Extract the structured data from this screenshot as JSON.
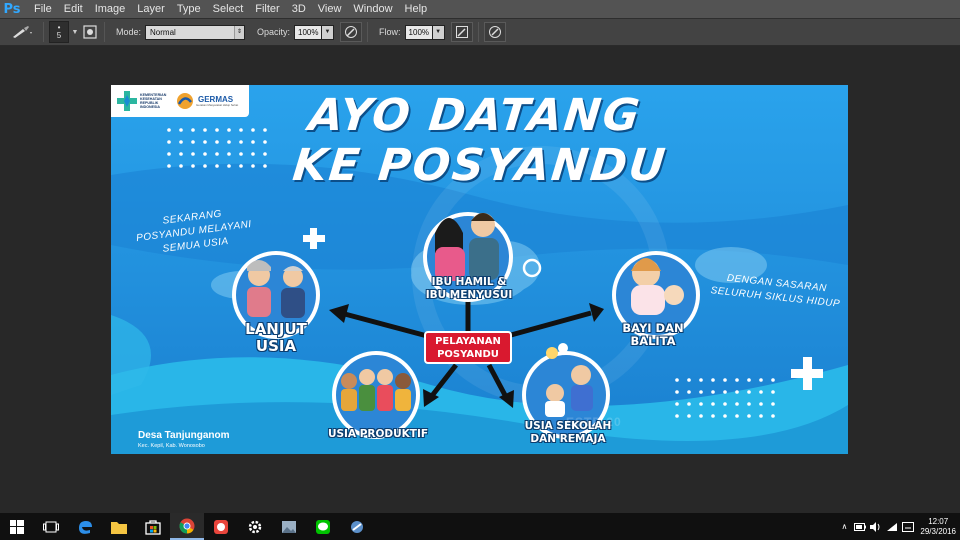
{
  "app": {
    "logo_text": "Ps"
  },
  "menu": [
    "File",
    "Edit",
    "Image",
    "Layer",
    "Type",
    "Select",
    "Filter",
    "3D",
    "View",
    "Window",
    "Help"
  ],
  "options": {
    "brush_size": "5",
    "mode_label": "Mode:",
    "mode_value": "Normal",
    "opacity_label": "Opacity:",
    "opacity_value": "100%",
    "flow_label": "Flow:",
    "flow_value": "100%"
  },
  "poster": {
    "logo_kemenkes": "KEMENTERIAN KESEHATAN REPUBLIK INDONESIA",
    "logo_germas": "GERMAS",
    "logo_germas_sub": "Gerakan Masyarakat Hidup Sehat",
    "title_line1": "AYO DATANG",
    "title_line2": "KE POSYANDU",
    "left_note": [
      "SEKARANG",
      "POSYANDU MELAYANI",
      "SEMUA USIA"
    ],
    "right_note": [
      "DENGAN SASARAN",
      "SELURUH SIKLUS HIDUP"
    ],
    "center": [
      "PELAYANAN",
      "POSYANDU"
    ],
    "groups": {
      "ibu": [
        "IBU HAMIL &",
        "IBU MENYUSUI"
      ],
      "lansia": [
        "LANJUT",
        "USIA"
      ],
      "bayi": [
        "BAYI DAN",
        "BALITA"
      ],
      "produktif": [
        "USIA PRODUKTIF"
      ],
      "sekolah": [
        "USIA SEKOLAH",
        "DAN REMAJA"
      ]
    },
    "village": "Desa Tanjunganom",
    "village_sub": "Kec. Kepil, Kab. Wonosobo",
    "watermark": "ESTD.20"
  },
  "taskbar": {
    "time": "12:07",
    "date": "29/3/2016",
    "icons": [
      "start-icon",
      "task-view-icon",
      "edge-icon",
      "file-explorer-icon",
      "store-icon",
      "chrome-icon",
      "app-red-icon",
      "settings-icon",
      "photos-icon",
      "line-icon",
      "app-icon"
    ]
  }
}
